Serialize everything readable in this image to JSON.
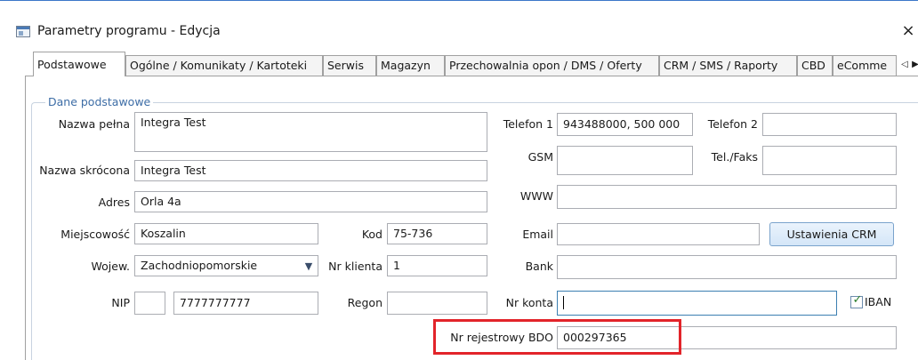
{
  "window": {
    "title": "Parametry programu - Edycja",
    "close_label": "×"
  },
  "tabs": [
    {
      "label": "Podstawowe",
      "active": true
    },
    {
      "label": "Ogólne / Komunikaty / Kartoteki"
    },
    {
      "label": "Serwis"
    },
    {
      "label": "Magazyn"
    },
    {
      "label": "Przechowalnia opon / DMS / Oferty"
    },
    {
      "label": "CRM / SMS / Raporty"
    },
    {
      "label": "CBD"
    },
    {
      "label": "eComme"
    }
  ],
  "tab_scroll": {
    "left": "◁",
    "right": "▶"
  },
  "group": {
    "title": "Dane podstawowe"
  },
  "form": {
    "nazwa_pelna": {
      "label": "Nazwa pełna",
      "value": "Integra Test"
    },
    "nazwa_skrocona": {
      "label": "Nazwa skrócona",
      "value": "Integra Test"
    },
    "adres": {
      "label": "Adres",
      "value": "Orla 4a"
    },
    "miejscowosc": {
      "label": "Miejscowość",
      "value": "Koszalin"
    },
    "kod": {
      "label": "Kod",
      "value": "75-736"
    },
    "wojew": {
      "label": "Wojew.",
      "value": "Zachodniopomorskie"
    },
    "nr_klienta": {
      "label": "Nr klienta",
      "value": "1"
    },
    "nip": {
      "label": "NIP",
      "prefix": "",
      "value": "7777777777"
    },
    "regon": {
      "label": "Regon",
      "value": ""
    },
    "telefon1": {
      "label": "Telefon 1",
      "value": "943488000, 500 000"
    },
    "telefon2": {
      "label": "Telefon 2",
      "value": ""
    },
    "gsm": {
      "label": "GSM",
      "value": ""
    },
    "tel_faks": {
      "label": "Tel./Faks",
      "value": ""
    },
    "www": {
      "label": "WWW",
      "value": ""
    },
    "email": {
      "label": "Email",
      "value": ""
    },
    "bank": {
      "label": "Bank",
      "value": ""
    },
    "nr_konta": {
      "label": "Nr konta",
      "value": ""
    },
    "iban": {
      "label": "IBAN",
      "checked": true
    },
    "bdo": {
      "label": "Nr rejestrowy BDO",
      "value": "000297365"
    }
  },
  "buttons": {
    "crm_settings": "Ustawienia CRM"
  },
  "icons": {
    "checkbox_mark": "✓",
    "combo_arrow": "▼"
  },
  "colors": {
    "highlight": "#e2242a",
    "accent": "#3c7fb1",
    "group_title": "#3d6da6"
  }
}
